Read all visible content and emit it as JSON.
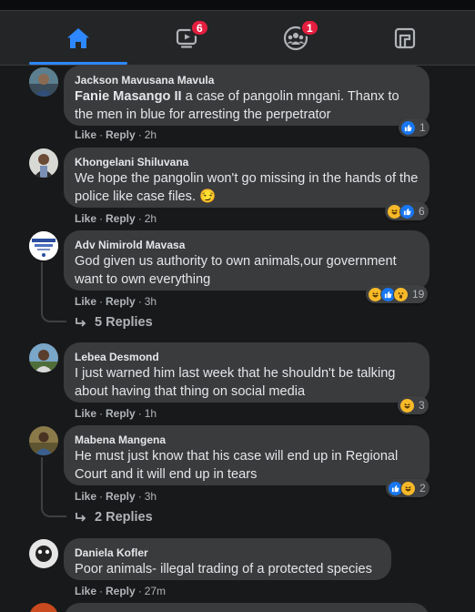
{
  "nav": {
    "watch_badge": "6",
    "groups_badge": "1",
    "active_color": "#2d88ff"
  },
  "actions": {
    "like": "Like",
    "reply": "Reply"
  },
  "comments": [
    {
      "author": "Jackson Mavusana Mavula",
      "mention": "Fanie Masango II",
      "text": " a case of pangolin mngani. Thanx to the men in blue for arresting the perpetrator",
      "time": "2h",
      "reaction_count": "1",
      "reactions": [
        "like-icon"
      ]
    },
    {
      "author": "Khongelani Shiluvana",
      "text": "We hope the pangolin won't go missing in the hands of the police like case files. 😏",
      "time": "2h",
      "reaction_count": "6",
      "reactions": [
        "haha-icon",
        "like-icon"
      ]
    },
    {
      "author": "Adv Nimirold Mavasa",
      "text": "God given us authority to own animals,our government want to own everything",
      "time": "3h",
      "reaction_count": "19",
      "reactions": [
        "haha-icon",
        "like-icon",
        "wow-icon"
      ],
      "replies_label": "5 Replies"
    },
    {
      "author": "Lebea Desmond",
      "text": "I just warned him last week that he shouldn't be talking about having that thing on social media",
      "time": "1h",
      "reaction_count": "3",
      "reactions": [
        "haha-icon"
      ]
    },
    {
      "author": "Mabena Mangena",
      "text": "He must just know that his case will end up in Regional Court and it will end up in tears",
      "time": "3h",
      "reaction_count": "2",
      "reactions": [
        "like-icon",
        "haha-icon"
      ],
      "replies_label": "2 Replies"
    },
    {
      "author": "Daniela Kofler",
      "text": "Poor animals- illegal trading of a protected species",
      "time": "27m"
    }
  ]
}
